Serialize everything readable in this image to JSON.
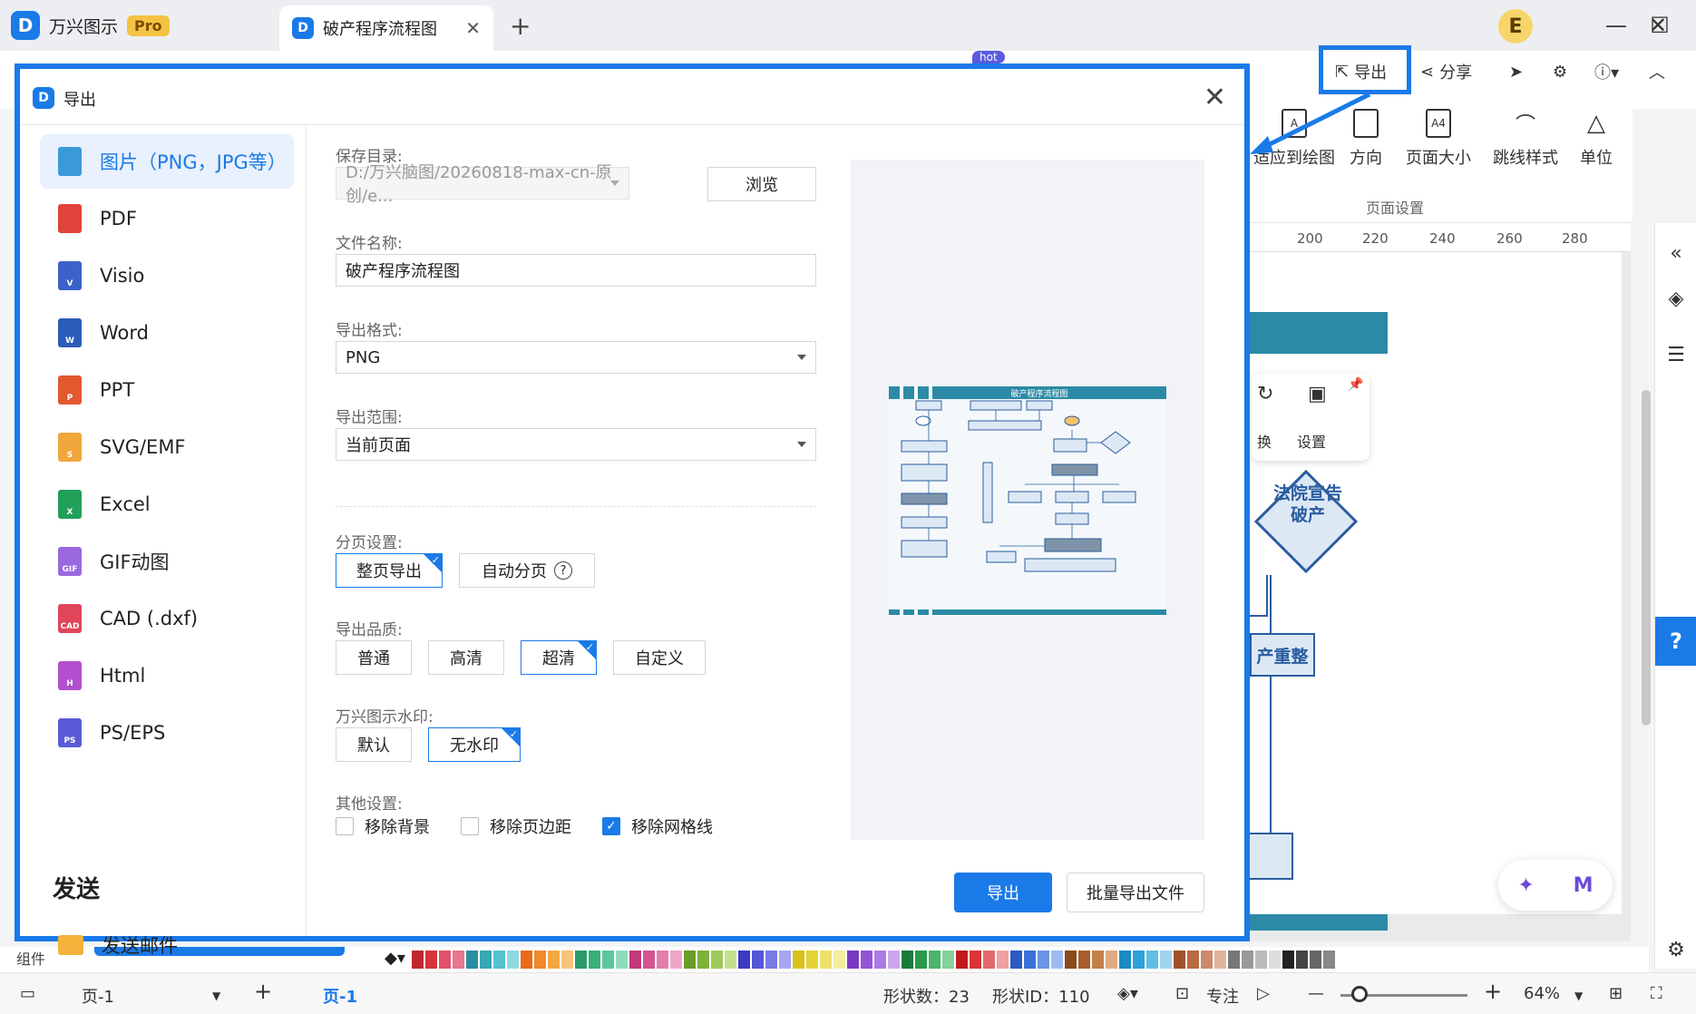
{
  "titlebar": {
    "app_name": "万兴图示",
    "pro_label": "Pro",
    "doc_tab": "破产程序流程图",
    "avatar_letter": "E"
  },
  "toolbar": {
    "export_label": "导出",
    "share_label": "分享",
    "hot_label": "hot"
  },
  "ribbon": {
    "items": [
      {
        "label": "适应到绘图"
      },
      {
        "label": "方向"
      },
      {
        "label": "页面大小"
      },
      {
        "label": "跳线样式"
      },
      {
        "label": "单位"
      }
    ],
    "group_label": "页面设置"
  },
  "ruler_ticks": [
    "200",
    "220",
    "240",
    "260",
    "280"
  ],
  "canvas": {
    "float_labels": [
      "换",
      "设置"
    ],
    "diamond_text": "法院宣告破产",
    "node_text": "产重整"
  },
  "dialog": {
    "title": "导出",
    "formats": [
      {
        "label": "图片（PNG，JPG等）",
        "icon": "image-icon",
        "color": "#3a9ad9",
        "abbr": ""
      },
      {
        "label": "PDF",
        "icon": "pdf-icon",
        "color": "#e0443a",
        "abbr": ""
      },
      {
        "label": "Visio",
        "icon": "visio-icon",
        "color": "#3a62c9",
        "abbr": "V"
      },
      {
        "label": "Word",
        "icon": "word-icon",
        "color": "#2b5cb8",
        "abbr": "W"
      },
      {
        "label": "PPT",
        "icon": "ppt-icon",
        "color": "#e2582f",
        "abbr": "P"
      },
      {
        "label": "SVG/EMF",
        "icon": "svg-icon",
        "color": "#f0a63b",
        "abbr": "S"
      },
      {
        "label": "Excel",
        "icon": "excel-icon",
        "color": "#21a05a",
        "abbr": "X"
      },
      {
        "label": "GIF动图",
        "icon": "gif-icon",
        "color": "#9b68e0",
        "abbr": "GIF"
      },
      {
        "label": "CAD (.dxf)",
        "icon": "cad-icon",
        "color": "#e0455a",
        "abbr": "CAD"
      },
      {
        "label": "Html",
        "icon": "html-icon",
        "color": "#b24fcf",
        "abbr": "H"
      },
      {
        "label": "PS/EPS",
        "icon": "ps-icon",
        "color": "#5b5ad8",
        "abbr": "PS"
      }
    ],
    "send_title": "发送",
    "send_email": "发送邮件",
    "save_dir_label": "保存目录:",
    "save_dir_value": "D:/万兴脑图/20260818-max-cn-原创/e...",
    "browse_label": "浏览",
    "filename_label": "文件名称:",
    "filename_value": "破产程序流程图",
    "format_label": "导出格式:",
    "format_value": "PNG",
    "range_label": "导出范围:",
    "range_value": "当前页面",
    "paging_label": "分页设置:",
    "paging_full": "整页导出",
    "paging_auto": "自动分页",
    "quality_label": "导出品质:",
    "quality_opts": [
      "普通",
      "高清",
      "超清",
      "自定义"
    ],
    "watermark_label": "万兴图示水印:",
    "watermark_default": "默认",
    "watermark_none": "无水印",
    "other_label": "其他设置:",
    "other_opts": [
      {
        "label": "移除背景",
        "checked": false
      },
      {
        "label": "移除页边距",
        "checked": false
      },
      {
        "label": "移除网格线",
        "checked": true
      }
    ],
    "export_btn": "导出",
    "batch_btn": "批量导出文件",
    "preview_title": "破产程序流程图"
  },
  "bottom": {
    "left_label": "组件",
    "page_select": "页-1",
    "page_tab": "页-1",
    "shape_count": "形状数：23",
    "shape_id": "形状ID：110",
    "focus_label": "专注",
    "zoom": "64%"
  },
  "palette": [
    "#c0272d",
    "#d8333c",
    "#e0526b",
    "#e8768c",
    "#2a8ea0",
    "#35a7b5",
    "#52c3cf",
    "#8ed8de",
    "#e86a1a",
    "#f08a2c",
    "#f4a742",
    "#f7c37a",
    "#2a9c6a",
    "#38b07a",
    "#5cc79a",
    "#8fdcbd",
    "#c23a7a",
    "#d55592",
    "#e47cae",
    "#eda6c8",
    "#6a9c2a",
    "#7fb23a",
    "#9cc95c",
    "#c2e08f",
    "#3a3ac2",
    "#5555d8",
    "#7a7ae4",
    "#a6a6ef",
    "#d8c21a",
    "#e6d236",
    "#efe06a",
    "#f5ec9f",
    "#7a3ac2",
    "#9255d8",
    "#ad7ae4",
    "#cda6ef",
    "#1a7a3a",
    "#2a9a4a",
    "#4ab46a",
    "#86d19c",
    "#c21a1a",
    "#d83636",
    "#e46a6a",
    "#efa0a0",
    "#2a5ac2",
    "#3a72d8",
    "#6a94e4",
    "#a0baef",
    "#8a4a1a",
    "#a85e2a",
    "#c4804a",
    "#dcab84",
    "#1a8ac2",
    "#2ea2d8",
    "#62bce4",
    "#9ed6ef",
    "#a0522d",
    "#b86a44",
    "#cc8a6a",
    "#e0b49c",
    "#777777",
    "#999999",
    "#bbbbbb",
    "#dddddd",
    "#222222",
    "#444444",
    "#666666",
    "#888888"
  ]
}
